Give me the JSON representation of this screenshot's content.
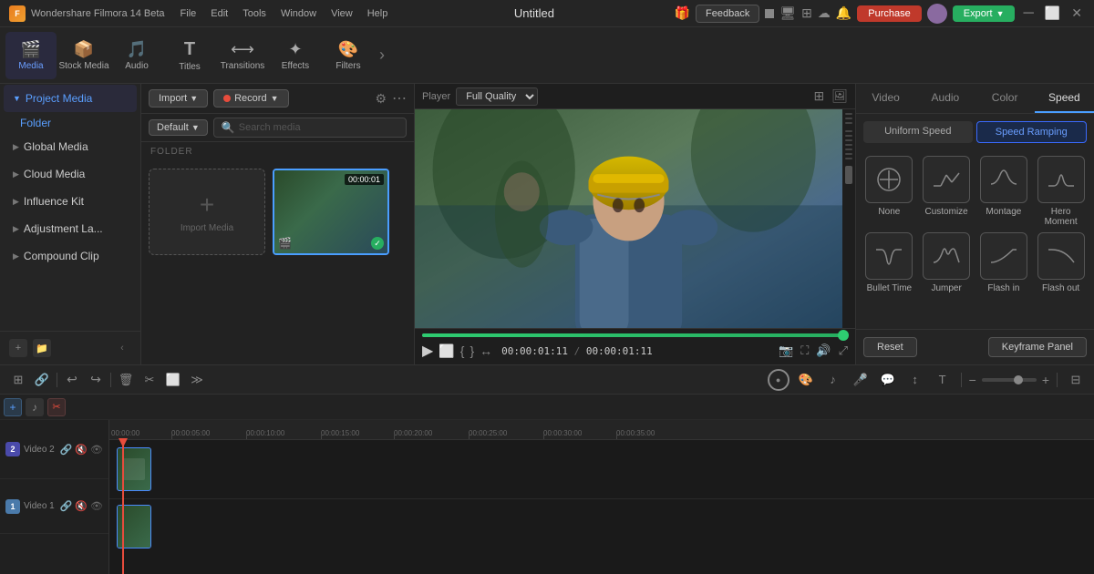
{
  "app": {
    "name": "Wondershare Filmora 14 Beta",
    "logo": "F"
  },
  "menu": {
    "items": [
      "File",
      "Edit",
      "Tools",
      "Window",
      "View",
      "Help"
    ]
  },
  "titlebar": {
    "project": "Untitled",
    "feedback_label": "Feedback",
    "purchase_label": "Purchase",
    "export_label": "Export"
  },
  "toolbar": {
    "items": [
      {
        "id": "media",
        "icon": "🎬",
        "label": "Media",
        "active": true
      },
      {
        "id": "stock",
        "icon": "📦",
        "label": "Stock Media",
        "active": false
      },
      {
        "id": "audio",
        "icon": "🎵",
        "label": "Audio",
        "active": false
      },
      {
        "id": "titles",
        "icon": "T",
        "label": "Titles",
        "active": false
      },
      {
        "id": "transitions",
        "icon": "⟷",
        "label": "Transitions",
        "active": false
      },
      {
        "id": "effects",
        "icon": "✨",
        "label": "Effects",
        "active": false
      },
      {
        "id": "filters",
        "icon": "🎨",
        "label": "Filters",
        "active": false
      }
    ]
  },
  "left_panel": {
    "sections": [
      {
        "id": "project-media",
        "label": "Project Media",
        "expanded": true
      },
      {
        "id": "global-media",
        "label": "Global Media",
        "expanded": false
      },
      {
        "id": "cloud-media",
        "label": "Cloud Media",
        "expanded": false
      },
      {
        "id": "influence-kit",
        "label": "Influence Kit",
        "expanded": false
      },
      {
        "id": "adjustment-la",
        "label": "Adjustment La...",
        "expanded": false
      },
      {
        "id": "compound-clip",
        "label": "Compound Clip",
        "expanded": false
      }
    ],
    "folder_label": "Folder"
  },
  "media_panel": {
    "import_label": "Import",
    "record_label": "Record",
    "default_label": "Default",
    "search_placeholder": "Search media",
    "folder_heading": "FOLDER",
    "import_media_label": "Import Media",
    "media_item": {
      "duration": "00:00:01",
      "has_check": true
    }
  },
  "player": {
    "label": "Player",
    "quality": "Full Quality",
    "current_time": "00:00:01:11",
    "total_time": "00:00:01:11",
    "progress_pct": 100
  },
  "right_panel": {
    "tabs": [
      "Video",
      "Audio",
      "Color",
      "Speed"
    ],
    "active_tab": "Speed",
    "speed": {
      "uniform_label": "Uniform Speed",
      "ramping_label": "Speed Ramping",
      "active_sub": "Speed Ramping",
      "items": [
        {
          "id": "none",
          "label": "None",
          "selected": false
        },
        {
          "id": "customize",
          "label": "Customize",
          "selected": false
        },
        {
          "id": "montage",
          "label": "Montage",
          "selected": false
        },
        {
          "id": "hero-moment",
          "label": "Hero Moment",
          "selected": false
        },
        {
          "id": "bullet-time",
          "label": "Bullet Time",
          "selected": false
        },
        {
          "id": "jumper",
          "label": "Jumper",
          "selected": false
        },
        {
          "id": "flash-in",
          "label": "Flash in",
          "selected": false
        },
        {
          "id": "flash-out",
          "label": "Flash out",
          "selected": false
        }
      ],
      "reset_label": "Reset",
      "keyframe_label": "Keyframe Panel"
    }
  },
  "timeline": {
    "toolbar": {
      "undo_label": "↩",
      "redo_label": "↪",
      "cut_label": "✂",
      "crop_label": "⬜"
    },
    "ruler_marks": [
      "00:00:00",
      "00:00:05:00",
      "00:00:10:00",
      "00:00:15:00",
      "00:00:20:00",
      "00:00:25:00",
      "00:00:30:00",
      "00:00:35:00"
    ],
    "tracks": [
      {
        "id": "video2",
        "number": "2",
        "name": "Video 2",
        "type": "v2"
      },
      {
        "id": "video1",
        "number": "1",
        "name": "Video 1",
        "type": "v1"
      }
    ]
  }
}
